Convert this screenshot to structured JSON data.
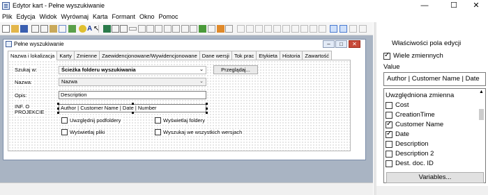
{
  "window": {
    "title": "Edytor kart - Pełne wyszukiwanie",
    "minimize": "—",
    "maximize": "☐",
    "close": "✕"
  },
  "menu": [
    "Plik",
    "Edycja",
    "Widok",
    "Wyrównaj",
    "Karta",
    "Formant",
    "Okno",
    "Pomoc"
  ],
  "child": {
    "title": "Pełne wyszukiwanie",
    "tabs": [
      "Nazwa i lokalizacja",
      "Karty",
      "Zmienne",
      "Zaewidencjonowane/Wywidencjonowane",
      "Dane wersji",
      "Tok prac",
      "Etykieta",
      "Historia",
      "Zawartość"
    ],
    "active_tab": 0,
    "form": {
      "search_in_label": "Szukaj w:",
      "search_in_value": "Ścieżka folderu wyszukiwania",
      "browse_label": "Przeglądaj...",
      "name_label": "Nazwa:",
      "name_value": "Nazwa",
      "desc_label": "Opis:",
      "desc_value": "Description",
      "info_label_1": "INF. O",
      "info_label_2": "PROJEKCIE",
      "info_value": "Author | Customer Name | Date | Number",
      "chk_subfolders": "Uwzględnij podfoldery",
      "chk_show_folders": "Wyświetlaj foldery",
      "chk_show_files": "Wyświetlaj pliki",
      "chk_all_versions": "Wyszukaj we wszystkich wersjach"
    }
  },
  "properties": {
    "title": "Właściwości pola edycji",
    "multi_vars": "Wiele zmiennych",
    "value_label": "Value",
    "value_text": "Author | Customer Name | Date",
    "list_header": "Uwzględniona zmienna",
    "variables": [
      {
        "name": "Cost",
        "checked": false
      },
      {
        "name": "CreationTime",
        "checked": false
      },
      {
        "name": "Customer Name",
        "checked": true
      },
      {
        "name": "Date",
        "checked": true
      },
      {
        "name": "Description",
        "checked": false
      },
      {
        "name": "Description 2",
        "checked": false
      },
      {
        "name": "Dest. doc. ID",
        "checked": false
      }
    ],
    "variables_button": "Variables..."
  }
}
